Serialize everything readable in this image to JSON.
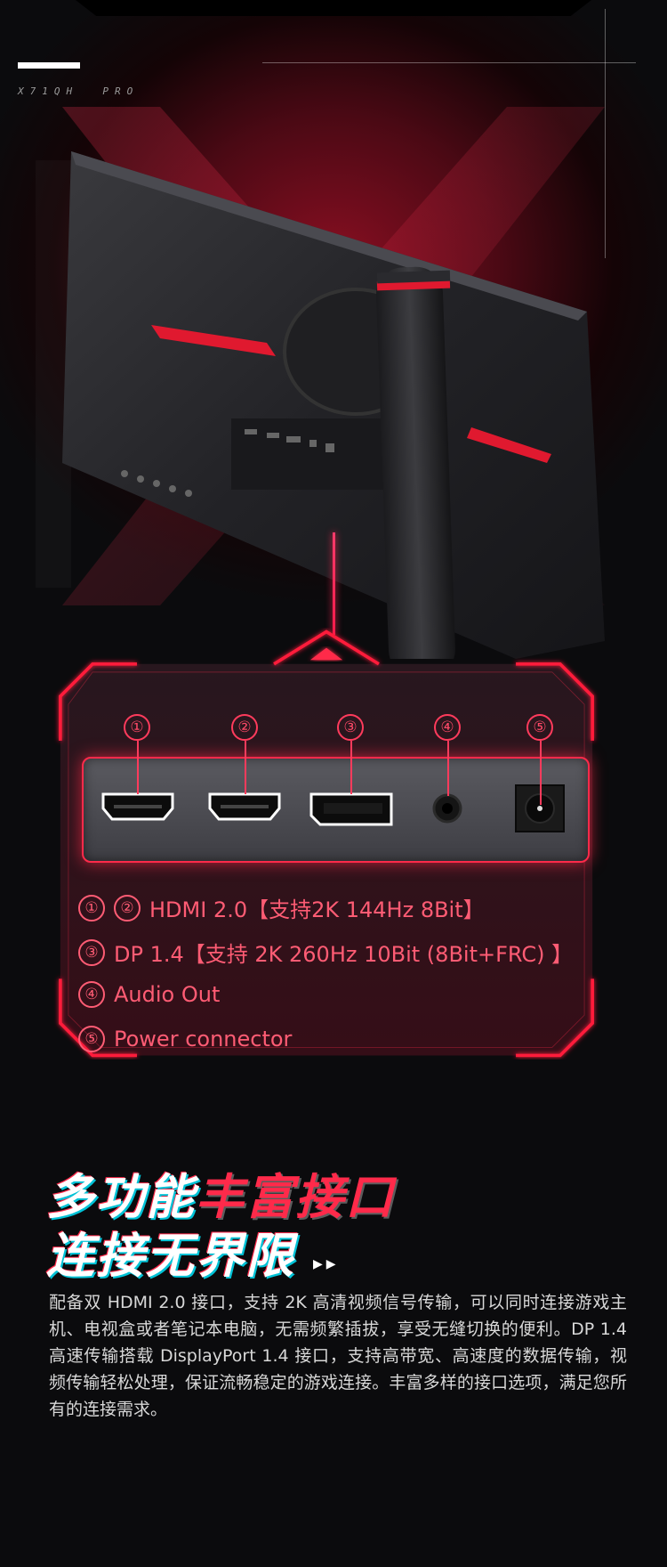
{
  "brand": {
    "model": "X71QH  PRO"
  },
  "ports": [
    {
      "num": "①",
      "name": "hdmi-port-1"
    },
    {
      "num": "②",
      "name": "hdmi-port-2"
    },
    {
      "num": "③",
      "name": "displayport"
    },
    {
      "num": "④",
      "name": "audio-jack"
    },
    {
      "num": "⑤",
      "name": "power-connector"
    }
  ],
  "specs": [
    {
      "circles": [
        "①",
        "②"
      ],
      "text": "HDMI 2.0【支持2K 144Hz  8Bit】"
    },
    {
      "circles": [
        "③"
      ],
      "text": "DP 1.4【支持 2K 260Hz 10Bit (8Bit+FRC) 】"
    },
    {
      "circles": [
        "④"
      ],
      "text": "Audio Out"
    },
    {
      "circles": [
        "⑤"
      ],
      "text": "Power connector"
    }
  ],
  "headline": {
    "line1_white": "多功能",
    "line1_red": "丰富接口",
    "line2": "连接无界限",
    "arrows": "▶▶"
  },
  "description": "配备双 HDMI 2.0 接口，支持 2K 高清视频信号传输，可以同时连接游戏主机、电视盒或者笔记本电脑，无需频繁插拔，享受无缝切换的便利。DP 1.4 高速传输搭载 DisplayPort 1.4 接口，支持高带宽、高速度的数据传输，视频传输轻松处理，保证流畅稳定的游戏连接。丰富多样的接口选项，满足您所有的连接需求。",
  "colors": {
    "accent": "#ff2a4a",
    "text_accent": "#ff5c74",
    "background": "#0b0b0d"
  }
}
